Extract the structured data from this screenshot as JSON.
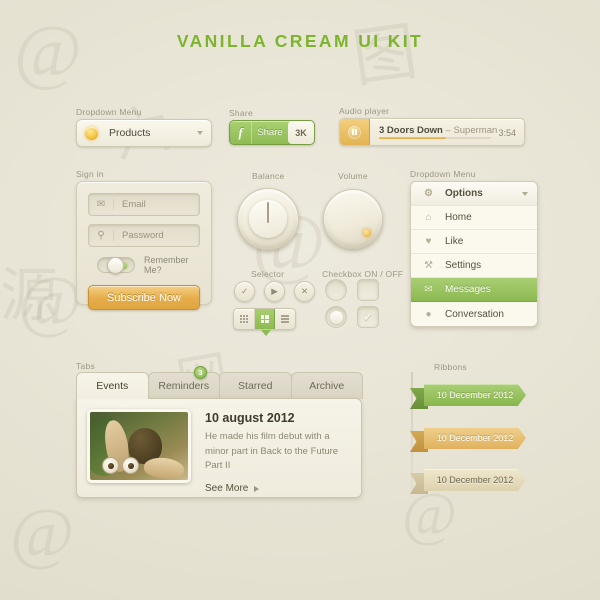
{
  "title": "VANILLA CREAM UI KIT",
  "captions": {
    "dropdown_menu_left": "Dropdown Menu",
    "share": "Share",
    "audio_player": "Audio player",
    "sign_in": "Sign in",
    "balance": "Balance",
    "volume": "Volume",
    "dropdown_menu_right": "Dropdown Menu",
    "selector": "Selector",
    "checkbox": "Checkbox ON / OFF",
    "tabs": "Tabs",
    "ribbons": "Ribbons"
  },
  "dropdown": {
    "selected": "Products",
    "icon": "bulb-icon",
    "caret": "chevron-down-icon"
  },
  "share_button": {
    "network_icon": "facebook-f-icon",
    "label": "Share",
    "count": "3K",
    "accent": "#8fbc53"
  },
  "audio": {
    "play_icon": "pause-icon",
    "artist": "3 Doors Down",
    "separator": " – ",
    "song": "Superman",
    "duration": "3:54",
    "progress_percent": 60,
    "accent": "#e0ae48"
  },
  "signin": {
    "email": {
      "icon": "envelope-icon",
      "placeholder": "Email",
      "value": ""
    },
    "password": {
      "icon": "key-icon",
      "placeholder": "Password",
      "value": ""
    },
    "remember_label": "Remember Me?",
    "remember_on": true,
    "submit_label": "Subscribe Now",
    "submit_color": "#e6ae4c"
  },
  "knobs": {
    "balance": {
      "label": "Balance",
      "indicator": "line",
      "position_deg": 0
    },
    "volume": {
      "label": "Volume",
      "indicator": "dot",
      "position_deg": 135
    }
  },
  "selector": {
    "buttons": [
      {
        "name": "check-button",
        "glyph": "✓"
      },
      {
        "name": "play-button",
        "glyph": "▶"
      },
      {
        "name": "close-button",
        "glyph": "✕"
      }
    ],
    "views": [
      {
        "name": "grid-small-view",
        "icon": "grid-3x3-icon",
        "active": false
      },
      {
        "name": "grid-large-view",
        "icon": "grid-2x2-icon",
        "active": true
      },
      {
        "name": "list-view",
        "icon": "list-icon",
        "active": false
      }
    ],
    "active_color": "#8dba51"
  },
  "checkbox": {
    "rows": [
      {
        "circle_on": false,
        "square_on": false
      },
      {
        "circle_on": true,
        "square_on": true
      }
    ],
    "check_glyph": "✓"
  },
  "menu": {
    "items": [
      {
        "icon": "gear-icon",
        "glyph": "⚙",
        "label": "Options",
        "header": true,
        "selected": false
      },
      {
        "icon": "home-icon",
        "glyph": "⌂",
        "label": "Home",
        "header": false,
        "selected": false
      },
      {
        "icon": "heart-icon",
        "glyph": "♥",
        "label": "Like",
        "header": false,
        "selected": false
      },
      {
        "icon": "wrench-icon",
        "glyph": "⚒",
        "label": "Settings",
        "header": false,
        "selected": false
      },
      {
        "icon": "envelope-icon",
        "glyph": "✉",
        "label": "Messages",
        "header": false,
        "selected": true
      },
      {
        "icon": "speech-bubble-icon",
        "glyph": "●",
        "label": "Conversation",
        "header": false,
        "selected": false
      }
    ],
    "selected_color": "#8cb951"
  },
  "tabs": {
    "items": [
      {
        "label": "Events",
        "active": true,
        "badge": null
      },
      {
        "label": "Reminders",
        "active": false,
        "badge": "3"
      },
      {
        "label": "Starred",
        "active": false,
        "badge": null
      },
      {
        "label": "Archive",
        "active": false,
        "badge": null
      }
    ],
    "badge_color": "#7eb441"
  },
  "card": {
    "thumbnail": "scrat-squirrel-acorn-image",
    "date": "10 august 2012",
    "description": "He made his film debut with a minor part in Back to the Future Part II",
    "see_more": "See More",
    "chevron": "chevron-right-icon"
  },
  "ribbons": [
    {
      "label": "10 December 2012",
      "color": "#88b64e"
    },
    {
      "label": "10 December 2012",
      "color": "#e0b25e"
    },
    {
      "label": "10 December 2012",
      "color": "#ddd2ae"
    }
  ],
  "watermarks": [
    "@",
    "@",
    "@",
    "@",
    "@",
    "@",
    "@",
    "图",
    "六",
    "网",
    "源"
  ]
}
